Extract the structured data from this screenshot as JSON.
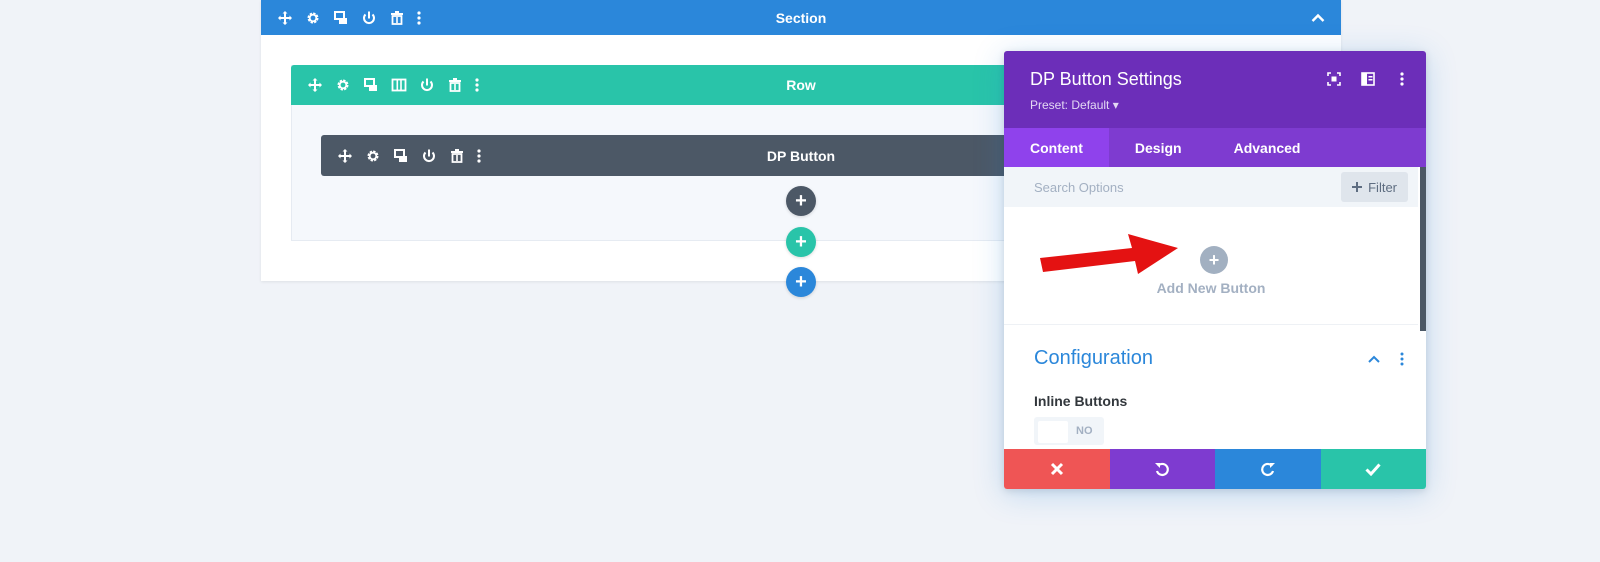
{
  "section": {
    "title": "Section",
    "color": "#2b87da",
    "icons": [
      "move-icon",
      "gear-icon",
      "duplicate-icon",
      "power-icon",
      "trash-icon",
      "more-icon"
    ]
  },
  "row": {
    "title": "Row",
    "color": "#29c4a9",
    "icons": [
      "move-icon",
      "gear-icon",
      "duplicate-icon",
      "columns-icon",
      "power-icon",
      "trash-icon",
      "more-icon"
    ]
  },
  "module": {
    "title": "DP Button",
    "color": "#4c5866",
    "icons": [
      "move-icon",
      "gear-icon",
      "duplicate-icon",
      "power-icon",
      "trash-icon",
      "more-icon"
    ]
  },
  "add_buttons": {
    "module_symbol": "+",
    "row_symbol": "+",
    "section_symbol": "+"
  },
  "panel": {
    "title": "DP Button Settings",
    "preset": "Preset: Default ▾",
    "tabs": [
      {
        "label": "Content",
        "active": true
      },
      {
        "label": "Design",
        "active": false
      },
      {
        "label": "Advanced",
        "active": false
      }
    ],
    "search_placeholder": "Search Options",
    "filter_label": "Filter",
    "add_new_symbol": "+",
    "add_new_label": "Add New Button",
    "config_title": "Configuration",
    "inline_buttons_label": "Inline Buttons",
    "inline_buttons_value": "NO",
    "colors": {
      "header": "#6c2eb9",
      "tabs": "#7e3bd0",
      "active_tab": "#8f42ec",
      "cancel": "#ef5555",
      "undo": "#7e3bd0",
      "redo": "#2b87da",
      "save": "#29c4a9"
    }
  }
}
